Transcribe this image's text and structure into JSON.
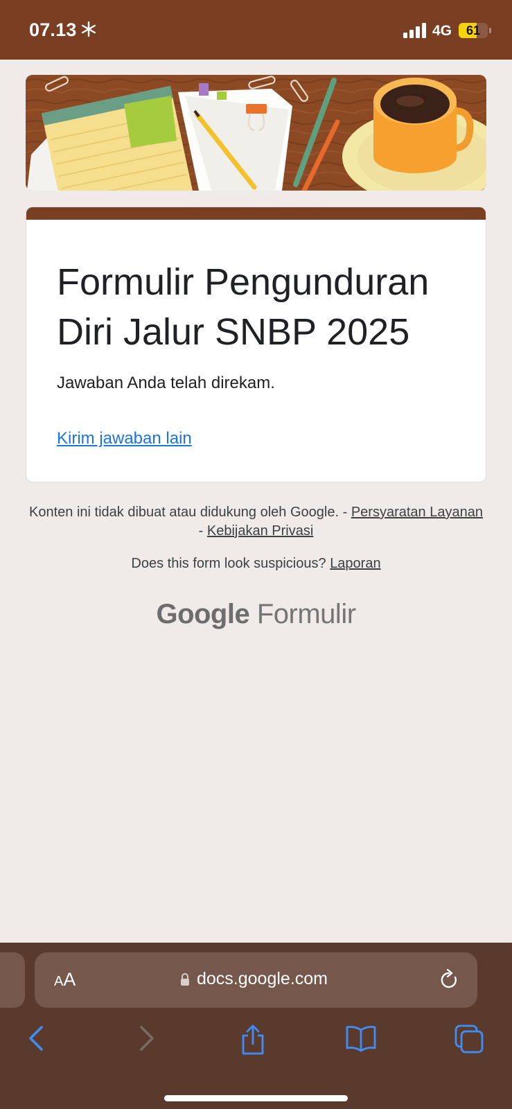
{
  "status_bar": {
    "time": "07.13",
    "network": "4G",
    "battery_level": "61",
    "battery_fraction": 0.61
  },
  "form": {
    "title": "Formulir Pengunduran Diri Jalur SNBP 2025",
    "confirmation": "Jawaban Anda telah direkam.",
    "another_response_link": "Kirim jawaban lain",
    "accent_color": "#7a3f22",
    "link_color": "#1a73e8"
  },
  "footer": {
    "disclaimer": "Konten ini tidak dibuat atau didukung oleh Google.",
    "separator": "-",
    "terms_link": "Persyaratan Layanan",
    "privacy_link": "Kebijakan Privasi",
    "suspicious_text": "Does this form look suspicious?",
    "report_link": "Laporan",
    "logo_google": "Google",
    "logo_product": "Formulir"
  },
  "browser": {
    "aa_small": "A",
    "aa_big": "A",
    "url": "docs.google.com"
  }
}
